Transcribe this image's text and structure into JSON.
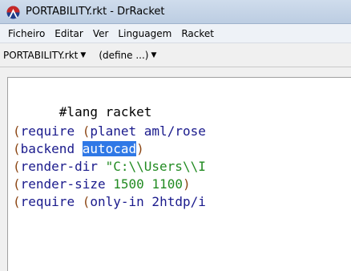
{
  "window": {
    "title": "PORTABILITY.rkt - DrRacket"
  },
  "menubar": {
    "items": [
      "Ficheiro",
      "Editar",
      "Ver",
      "Linguagem",
      "Racket"
    ]
  },
  "filebar": {
    "file_label": "PORTABILITY.rkt",
    "define_label": "(define ...)"
  },
  "editor": {
    "lines": {
      "l1": {
        "a": "#lang racket"
      },
      "l3": {
        "p1": "(",
        "kw": "require",
        "sp": " ",
        "p2": "(",
        "kw2": "planet",
        "rest": " aml/rose"
      },
      "l4": {
        "p1": "(",
        "kw": "backend",
        "sp": " ",
        "sel": "autocad",
        "p2": ")"
      },
      "l5": {
        "p1": "(",
        "kw": "render-dir",
        "sp": " ",
        "str": "\"C:\\\\Users\\\\I"
      },
      "l6": {
        "p1": "(",
        "kw": "render-size",
        "sp": " ",
        "n1": "1500",
        "sp2": " ",
        "n2": "1100",
        "p2": ")"
      },
      "l7": {
        "p1": "(",
        "kw": "require",
        "sp": " ",
        "p2": "(",
        "kw2": "only-in",
        "rest": " 2htdp/i"
      }
    }
  },
  "colors": {
    "keyword": "#1a1a8c",
    "paren": "#8b4513",
    "literal": "#228b22",
    "selection": "#2f78e6"
  }
}
